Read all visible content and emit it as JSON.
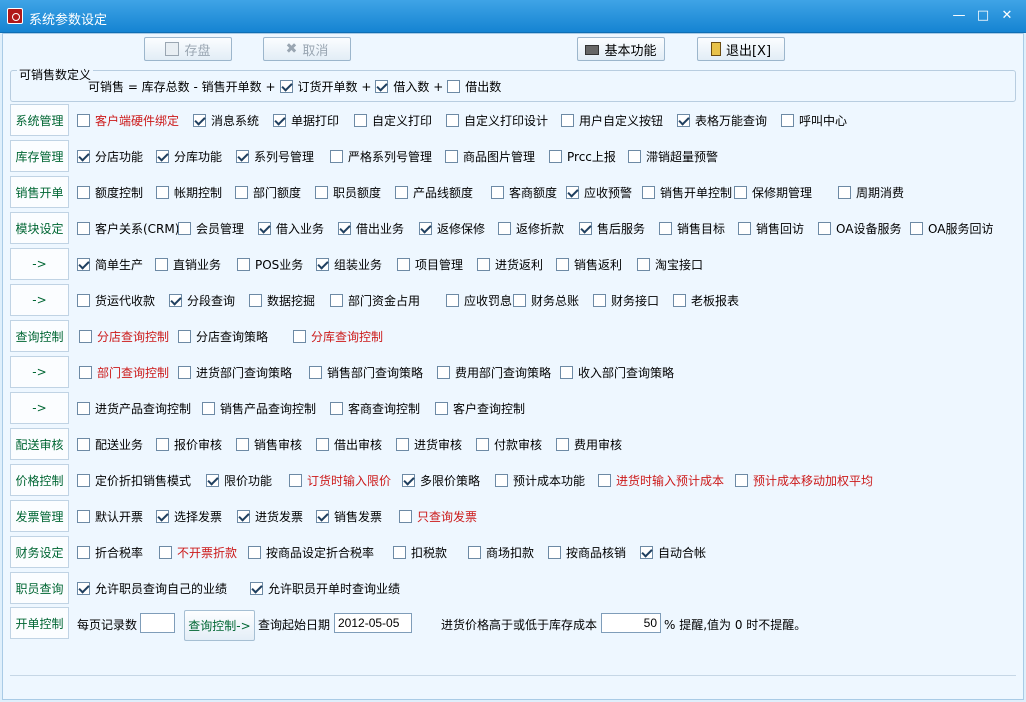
{
  "window": {
    "title": "系统参数设定",
    "controls": {
      "minimize": "—",
      "maximize": "□",
      "close": "✕"
    }
  },
  "toolbar": {
    "save": "存盘",
    "cancel": "取消",
    "basic": "基本功能",
    "exit": "退出[X]"
  },
  "formula": {
    "legend": "可销售数定义",
    "text": "可销售 = 库存总数 - 销售开单数 +",
    "items": [
      {
        "label": "订货开单数 +",
        "checked": true
      },
      {
        "label": "借入数 +",
        "checked": true
      },
      {
        "label": "借出数",
        "checked": false
      }
    ]
  },
  "rows": [
    {
      "label": "系统管理",
      "options": [
        {
          "label": "客户端硬件绑定",
          "checked": false,
          "red": true
        },
        {
          "label": "消息系统",
          "checked": true
        },
        {
          "label": "单据打印",
          "checked": true
        },
        {
          "label": "自定义打印",
          "checked": false
        },
        {
          "label": "自定义打印设计",
          "checked": false
        },
        {
          "label": "用户自定义按钮",
          "checked": false
        },
        {
          "label": "表格万能查询",
          "checked": true
        },
        {
          "label": "呼叫中心",
          "checked": false
        }
      ]
    },
    {
      "label": "库存管理",
      "options": [
        {
          "label": "分店功能",
          "checked": true
        },
        {
          "label": "分库功能",
          "checked": true
        },
        {
          "label": "系列号管理",
          "checked": true
        },
        {
          "label": "严格系列号管理",
          "checked": false
        },
        {
          "label": "商品图片管理",
          "checked": false
        },
        {
          "label": "Prcc上报",
          "checked": false
        },
        {
          "label": "滞销超量预警",
          "checked": false
        }
      ]
    },
    {
      "label": "销售开单",
      "options": [
        {
          "label": "额度控制",
          "checked": false
        },
        {
          "label": "帐期控制",
          "checked": false
        },
        {
          "label": "部门额度",
          "checked": false
        },
        {
          "label": "职员额度",
          "checked": false
        },
        {
          "label": "产品线额度",
          "checked": false
        },
        {
          "label": "客商额度",
          "checked": false
        },
        {
          "label": "应收预警",
          "checked": true
        },
        {
          "label": "销售开单控制",
          "checked": false
        },
        {
          "label": "保修期管理",
          "checked": false
        },
        {
          "label": "周期消费",
          "checked": false
        }
      ]
    },
    {
      "label": "模块设定",
      "options": [
        {
          "label": "客户关系(CRM)",
          "checked": false
        },
        {
          "label": "会员管理",
          "checked": false
        },
        {
          "label": "借入业务",
          "checked": true
        },
        {
          "label": "借出业务",
          "checked": true
        },
        {
          "label": "返修保修",
          "checked": true
        },
        {
          "label": "返修折款",
          "checked": false
        },
        {
          "label": "售后服务",
          "checked": true
        },
        {
          "label": "销售目标",
          "checked": false
        },
        {
          "label": "销售回访",
          "checked": false
        },
        {
          "label": "OA设备服务",
          "checked": false
        },
        {
          "label": "OA服务回访",
          "checked": false
        }
      ]
    },
    {
      "label": "->",
      "options": [
        {
          "label": "简单生产",
          "checked": true
        },
        {
          "label": "直销业务",
          "checked": false
        },
        {
          "label": "POS业务",
          "checked": false
        },
        {
          "label": "组装业务",
          "checked": true
        },
        {
          "label": "项目管理",
          "checked": false
        },
        {
          "label": "进货返利",
          "checked": false
        },
        {
          "label": "销售返利",
          "checked": false
        },
        {
          "label": "淘宝接口",
          "checked": false
        }
      ]
    },
    {
      "label": "->",
      "options": [
        {
          "label": "货运代收款",
          "checked": false
        },
        {
          "label": "分段查询",
          "checked": true
        },
        {
          "label": "数据挖掘",
          "checked": false
        },
        {
          "label": "部门资金占用",
          "checked": false
        },
        {
          "label": "应收罚息",
          "checked": false
        },
        {
          "label": "财务总账",
          "checked": false
        },
        {
          "label": "财务接口",
          "checked": false
        },
        {
          "label": "老板报表",
          "checked": false
        }
      ]
    },
    {
      "label": "查询控制",
      "options": [
        {
          "label": "分店查询控制",
          "checked": false,
          "red": true
        },
        {
          "label": "分店查询策略",
          "checked": false
        },
        {
          "label": "分库查询控制",
          "checked": false,
          "red": true
        }
      ]
    },
    {
      "label": "->",
      "options": [
        {
          "label": "部门查询控制",
          "checked": false,
          "red": true
        },
        {
          "label": "进货部门查询策略",
          "checked": false
        },
        {
          "label": "销售部门查询策略",
          "checked": false
        },
        {
          "label": "费用部门查询策略",
          "checked": false
        },
        {
          "label": "收入部门查询策略",
          "checked": false
        }
      ]
    },
    {
      "label": "->",
      "options": [
        {
          "label": "进货产品查询控制",
          "checked": false
        },
        {
          "label": "销售产品查询控制",
          "checked": false
        },
        {
          "label": "客商查询控制",
          "checked": false
        },
        {
          "label": "客户查询控制",
          "checked": false
        }
      ]
    },
    {
      "label": "配送审核",
      "options": [
        {
          "label": "配送业务",
          "checked": false
        },
        {
          "label": "报价审核",
          "checked": false
        },
        {
          "label": "销售审核",
          "checked": false
        },
        {
          "label": "借出审核",
          "checked": false
        },
        {
          "label": "进货审核",
          "checked": false
        },
        {
          "label": "付款审核",
          "checked": false
        },
        {
          "label": "费用审核",
          "checked": false
        }
      ]
    },
    {
      "label": "价格控制",
      "options": [
        {
          "label": "定价折扣销售模式",
          "checked": false
        },
        {
          "label": "限价功能",
          "checked": true
        },
        {
          "label": "订货时输入限价",
          "checked": false,
          "red": true
        },
        {
          "label": "多限价策略",
          "checked": true
        },
        {
          "label": "预计成本功能",
          "checked": false
        },
        {
          "label": "进货时输入预计成本",
          "checked": false,
          "red": true
        },
        {
          "label": "预计成本移动加权平均",
          "checked": false,
          "red": true
        }
      ]
    },
    {
      "label": "发票管理",
      "options": [
        {
          "label": "默认开票",
          "checked": false
        },
        {
          "label": "选择发票",
          "checked": true
        },
        {
          "label": "进货发票",
          "checked": true
        },
        {
          "label": "销售发票",
          "checked": true
        },
        {
          "label": "只查询发票",
          "checked": false,
          "red": true
        }
      ]
    },
    {
      "label": "财务设定",
      "options": [
        {
          "label": "折合税率",
          "checked": false
        },
        {
          "label": "不开票折款",
          "checked": false,
          "red": true
        },
        {
          "label": "按商品设定折合税率",
          "checked": false
        },
        {
          "label": "扣税款",
          "checked": false
        },
        {
          "label": "商场扣款",
          "checked": false
        },
        {
          "label": "按商品核销",
          "checked": false
        },
        {
          "label": "自动合帐",
          "checked": true
        }
      ]
    },
    {
      "label": "职员查询",
      "options": [
        {
          "label": "允许职员查询自己的业绩",
          "checked": true
        },
        {
          "label": "允许职员开单时查询业绩",
          "checked": true
        }
      ]
    }
  ],
  "footer_row": {
    "label": "开单控制",
    "per_page_label": "每页记录数",
    "per_page_value": "",
    "query_button": "查询控制->",
    "start_date_label": "查询起始日期",
    "start_date_value": "2012-05-05",
    "price_label": "进货价格高于或低于库存成本",
    "price_value": "50",
    "price_suffix": "% 提醒,值为 0 时不提醒。"
  }
}
